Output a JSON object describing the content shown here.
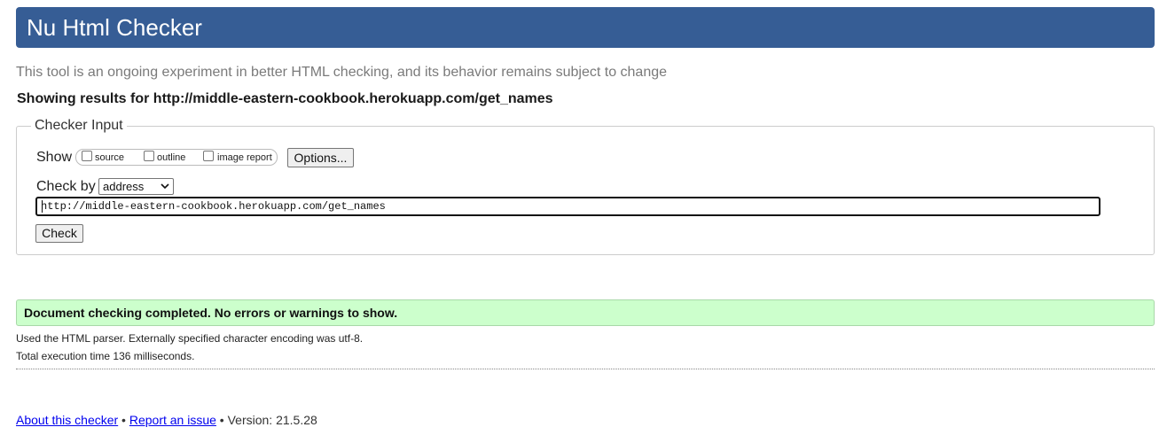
{
  "header": {
    "title": "Nu Html Checker",
    "tagline": "This tool is an ongoing experiment in better HTML checking, and its behavior remains subject to change",
    "results_for": "Showing results for http://middle-eastern-cookbook.herokuapp.com/get_names"
  },
  "checker_input": {
    "legend": "Checker Input",
    "show_label": "Show",
    "show_options": [
      {
        "label": "source",
        "checked": false
      },
      {
        "label": "outline",
        "checked": false
      },
      {
        "label": "image report",
        "checked": false
      }
    ],
    "options_button": "Options...",
    "check_by_label": "Check by",
    "check_by_value": "address",
    "url_value": "http://middle-eastern-cookbook.herokuapp.com/get_names",
    "check_button": "Check"
  },
  "result": {
    "message": "Document checking completed. No errors or warnings to show.",
    "parser_info": "Used the HTML parser. Externally specified character encoding was utf-8.",
    "execution_time": "Total execution time 136 milliseconds."
  },
  "footer": {
    "about_link": "About this checker",
    "separator1": " • ",
    "report_link": "Report an issue",
    "separator2": " • ",
    "version": "Version: 21.5.28"
  },
  "colors": {
    "banner": "#365d95",
    "success_bg": "#ccffcc",
    "link": "#0000ee"
  }
}
